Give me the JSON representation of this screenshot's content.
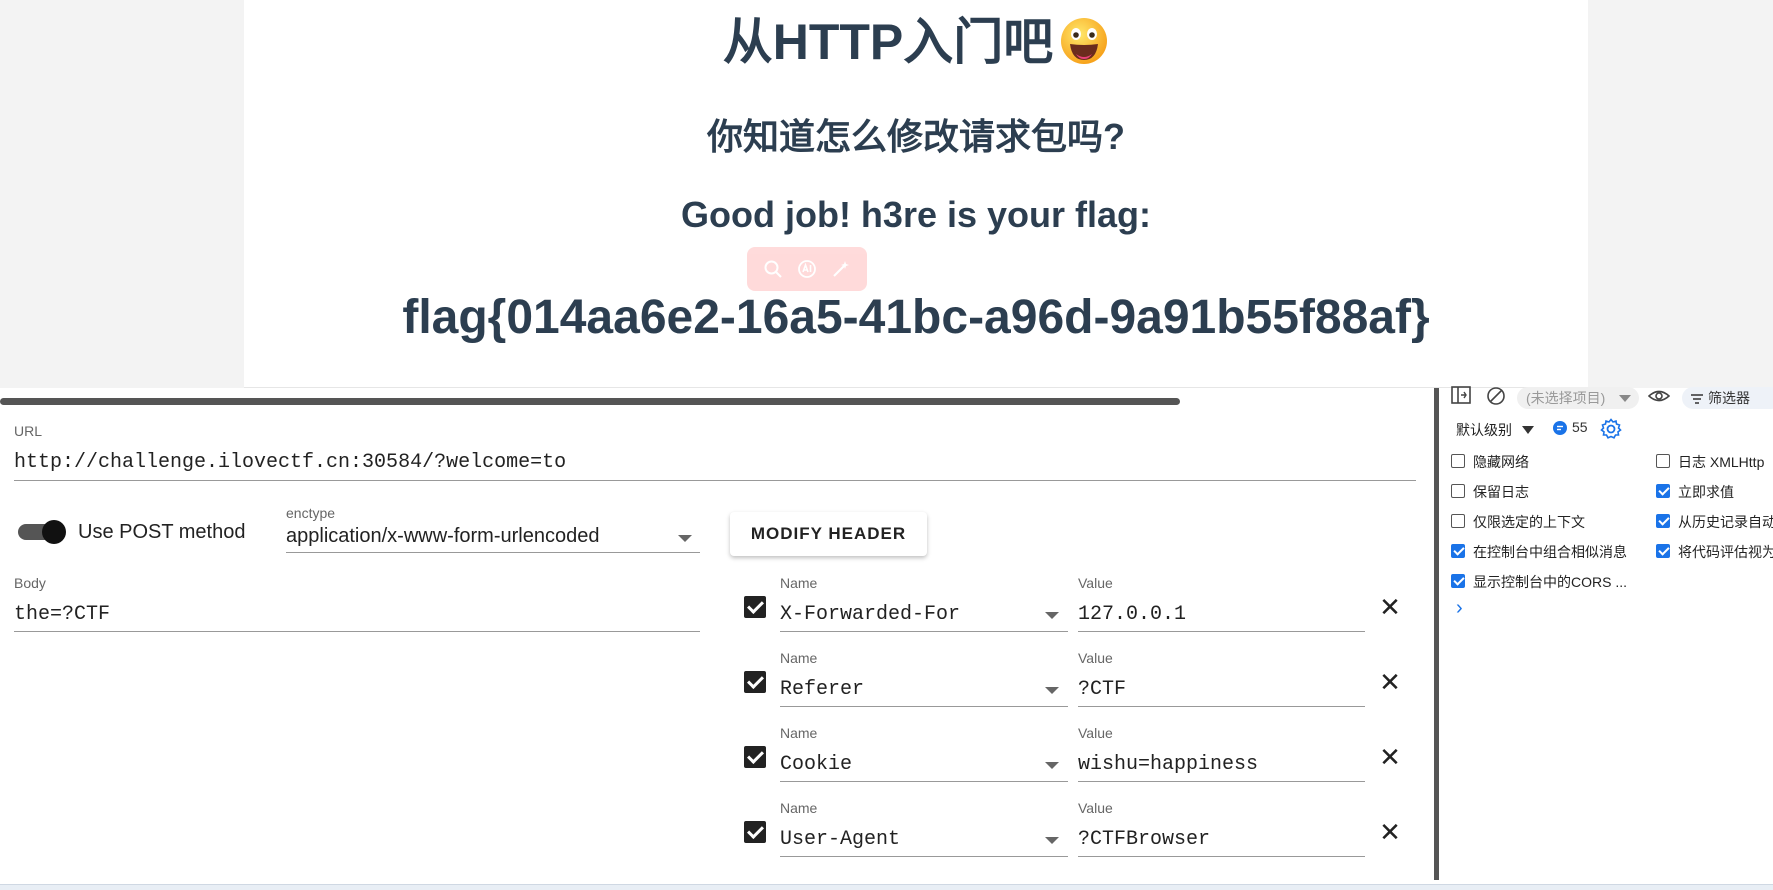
{
  "page": {
    "title": "从HTTP入门吧",
    "subtitle": "你知道怎么修改请求包吗?",
    "goodjob": "Good job! h3re is your flag:",
    "flag": "flag{014aa6e2-16a5-41bc-a96d-9a91b55f88af}"
  },
  "hackbar": {
    "url_label": "URL",
    "url_value": "http://challenge.ilovectf.cn:30584/?welcome=to",
    "post_toggle_label": "Use POST method",
    "post_enabled": true,
    "enctype_label": "enctype",
    "enctype_value": "application/x-www-form-urlencoded",
    "modify_header_label": "MODIFY HEADER",
    "body_label": "Body",
    "body_value": "the=?CTF",
    "name_label": "Name",
    "value_label": "Value",
    "headers": [
      {
        "enabled": true,
        "name": "X-Forwarded-For",
        "value": "127.0.0.1"
      },
      {
        "enabled": true,
        "name": "Referer",
        "value": "?CTF"
      },
      {
        "enabled": true,
        "name": "Cookie",
        "value": "wishu=happiness"
      },
      {
        "enabled": true,
        "name": "User-Agent",
        "value": "?CTFBrowser"
      }
    ]
  },
  "devtools": {
    "context_placeholder": "(未选择项目)",
    "filter_label": "筛选器",
    "level_label": "默认级别",
    "message_count": "55",
    "left_options": [
      {
        "label": "隐藏网络",
        "checked": false
      },
      {
        "label": "保留日志",
        "checked": false
      },
      {
        "label": "仅限选定的上下文",
        "checked": false
      },
      {
        "label": "在控制台中组合相似消息",
        "checked": true
      },
      {
        "label": "显示控制台中的CORS ...",
        "checked": true
      }
    ],
    "right_options": [
      {
        "label": "日志 XMLHttp",
        "checked": false
      },
      {
        "label": "立即求值",
        "checked": true
      },
      {
        "label": "从历史记录自动",
        "checked": true
      },
      {
        "label": "将代码评估视为",
        "checked": true
      }
    ],
    "prompt": "›"
  }
}
